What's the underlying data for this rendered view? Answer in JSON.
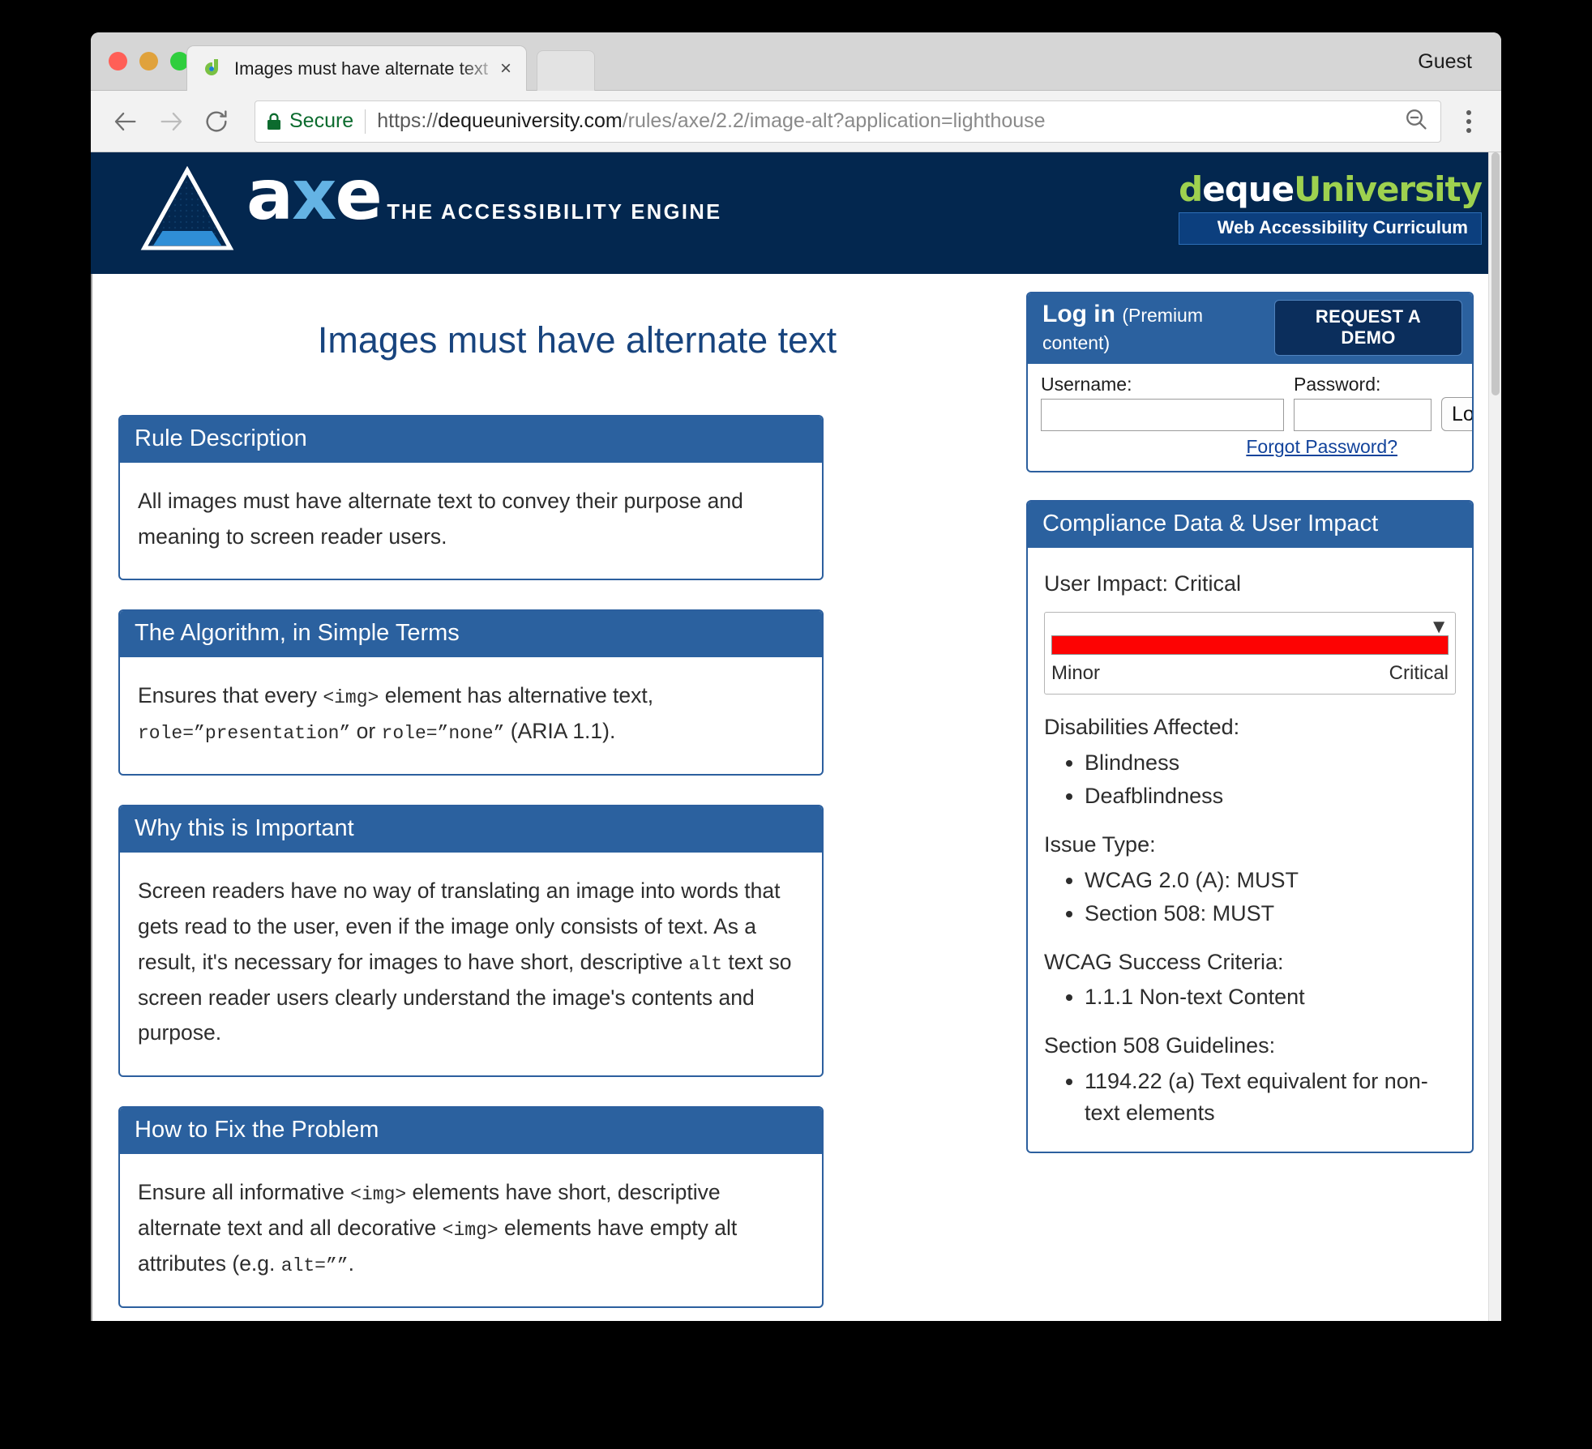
{
  "browser": {
    "guest_label": "Guest",
    "tab": {
      "title": "Images must have alternate text",
      "favicon": "deque-d-icon",
      "close": "×"
    },
    "toolbar": {
      "back": "back-arrow-icon",
      "forward": "forward-arrow-icon",
      "reload": "reload-icon",
      "secure_label": "Secure",
      "url_scheme": "https://",
      "url_host": "dequeuniversity.com",
      "url_path": "/rules/axe/2.2/image-alt?application=lighthouse",
      "url_full": "https://dequeuniversity.com/rules/axe/2.2/image-alt?application=lighthouse",
      "zoom_out": "zoom-out-icon",
      "menu": "three-dot-menu-icon"
    }
  },
  "masthead": {
    "logo_word_a": "a",
    "logo_word_x": "x",
    "logo_word_e": "e",
    "tagline": "THE ACCESSIBILITY ENGINE",
    "deque_d": "d",
    "deque_eque": "eque",
    "deque_university": "University",
    "badge": "Web Accessibility Curriculum",
    "colors": {
      "navy": "#03274f",
      "light_blue": "#64b3e4",
      "green": "#9ed14f",
      "badge_bg": "#0c3f7e"
    }
  },
  "page": {
    "title": "Images must have alternate text"
  },
  "panels": [
    {
      "heading": "Rule Description",
      "body_html": "All images must have alternate text to convey their purpose and meaning to screen reader users."
    },
    {
      "heading": "The Algorithm, in Simple Terms",
      "body_html": "Ensures that every <code>&lt;img&gt;</code> element has alternative text, <code>role=”presentation”</code> or <code>role=”none”</code> (ARIA 1.1)."
    },
    {
      "heading": "Why this is Important",
      "body_html": "Screen readers have no way of translating an image into words that gets read to the user, even if the image only consists of text. As a result, it's necessary for images to have short, descriptive <code>alt</code> text so screen reader users clearly understand the image's contents and purpose."
    },
    {
      "heading": "How to Fix the Problem",
      "body_html": "Ensure all informative <code>&lt;img&gt;</code> elements have short, descriptive alternate text and all decorative <code>&lt;img&gt;</code> elements have empty alt attributes (e.g. <code>alt=””</code>."
    }
  ],
  "login": {
    "title": "Log in",
    "subtitle": "(Premium content)",
    "demo_button": "REQUEST A DEMO",
    "username_label": "Username:",
    "username_value": "",
    "password_label": "Password:",
    "password_value": "",
    "login_button": "Login",
    "forgot_link": "Forgot Password?"
  },
  "compliance": {
    "heading": "Compliance Data & User Impact",
    "impact_label": "User Impact: Critical",
    "meter": {
      "min_label": "Minor",
      "max_label": "Critical",
      "fill_percent": 100,
      "marker_percent": 100,
      "bar_color": "#fd0303"
    },
    "sections": [
      {
        "label": "Disabilities Affected:",
        "items": [
          "Blindness",
          "Deafblindness"
        ]
      },
      {
        "label": "Issue Type:",
        "items": [
          "WCAG 2.0 (A): MUST",
          "Section 508: MUST"
        ]
      },
      {
        "label": "WCAG Success Criteria:",
        "items": [
          "1.1.1 Non-text Content"
        ]
      },
      {
        "label": "Section 508 Guidelines:",
        "items": [
          "1194.22 (a) Text equivalent for non-text elements"
        ]
      }
    ]
  }
}
